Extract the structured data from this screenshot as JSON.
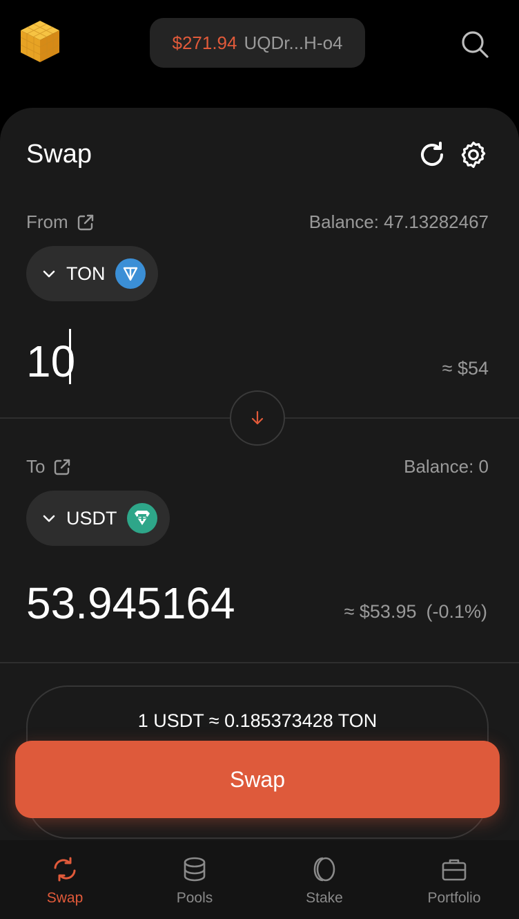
{
  "header": {
    "wallet_amount": "$271.94",
    "wallet_address": "UQDr...H-o4"
  },
  "swap": {
    "title": "Swap",
    "from": {
      "label": "From",
      "balance": "Balance: 47.13282467",
      "token": "TON",
      "amount": "10",
      "usd": "≈ $54"
    },
    "to": {
      "label": "To",
      "balance": "Balance: 0",
      "token": "USDT",
      "amount": "53.945164",
      "usd": "≈ $53.95",
      "impact": "(-0.1%)"
    },
    "rate": "1 USDT ≈ 0.185373428 TON",
    "button_label": "Swap"
  },
  "nav": {
    "items": [
      {
        "label": "Swap",
        "icon": "swap-icon",
        "active": true
      },
      {
        "label": "Pools",
        "icon": "pools-icon",
        "active": false
      },
      {
        "label": "Stake",
        "icon": "stake-icon",
        "active": false
      },
      {
        "label": "Portfolio",
        "icon": "portfolio-icon",
        "active": false
      }
    ]
  },
  "colors": {
    "accent": "#de5a3b",
    "background": "#1a1a1a",
    "ton": "#3b8fd6",
    "usdt": "#2ea689"
  }
}
